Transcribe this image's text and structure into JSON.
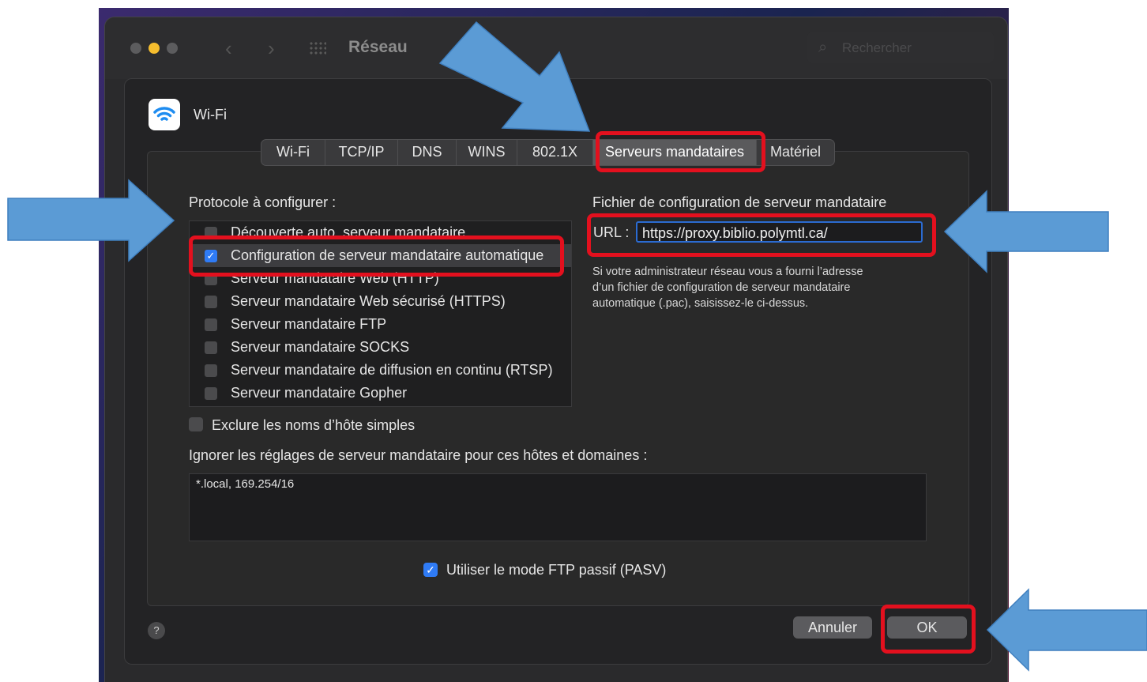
{
  "window": {
    "title": "Réseau",
    "search_placeholder": "Rechercher"
  },
  "header": {
    "interface_name": "Wi-Fi"
  },
  "tabs": [
    {
      "label": "Wi-Fi",
      "active": false
    },
    {
      "label": "TCP/IP",
      "active": false
    },
    {
      "label": "DNS",
      "active": false
    },
    {
      "label": "WINS",
      "active": false
    },
    {
      "label": "802.1X",
      "active": false
    },
    {
      "label": "Serveurs mandataires",
      "active": true
    },
    {
      "label": "Matériel",
      "active": false
    }
  ],
  "protocols": {
    "heading": "Protocole à configurer :",
    "items": [
      {
        "label": "Découverte auto. serveur mandataire",
        "checked": false
      },
      {
        "label": "Configuration de serveur mandataire automatique",
        "checked": true
      },
      {
        "label": "Serveur mandataire Web (HTTP)",
        "checked": false
      },
      {
        "label": "Serveur mandataire Web sécurisé (HTTPS)",
        "checked": false
      },
      {
        "label": "Serveur mandataire FTP",
        "checked": false
      },
      {
        "label": "Serveur mandataire SOCKS",
        "checked": false
      },
      {
        "label": "Serveur mandataire de diffusion en continu (RTSP)",
        "checked": false
      },
      {
        "label": "Serveur mandataire Gopher",
        "checked": false
      }
    ]
  },
  "config_file": {
    "heading": "Fichier de configuration de serveur mandataire",
    "url_label": "URL :",
    "url_value": "https://proxy.biblio.polymtl.ca/",
    "help_line1": "Si votre administrateur réseau vous a fourni l’adresse",
    "help_line2": "d’un fichier de configuration de serveur mandataire",
    "help_line3": "automatique (.pac), saisissez-le ci-dessus."
  },
  "exclude_simple": {
    "label": "Exclure les noms d’hôte simples",
    "checked": false
  },
  "bypass": {
    "heading": "Ignorer les réglages de serveur mandataire pour ces hôtes et domaines :",
    "value": "*.local, 169.254/16"
  },
  "pasv": {
    "label": "Utiliser le mode FTP passif (PASV)",
    "checked": true
  },
  "buttons": {
    "cancel": "Annuler",
    "ok": "OK",
    "help": "?"
  },
  "colors": {
    "accent": "#2f7bf5",
    "highlight": "#e3101e",
    "arrow": "#5b9bd5"
  }
}
